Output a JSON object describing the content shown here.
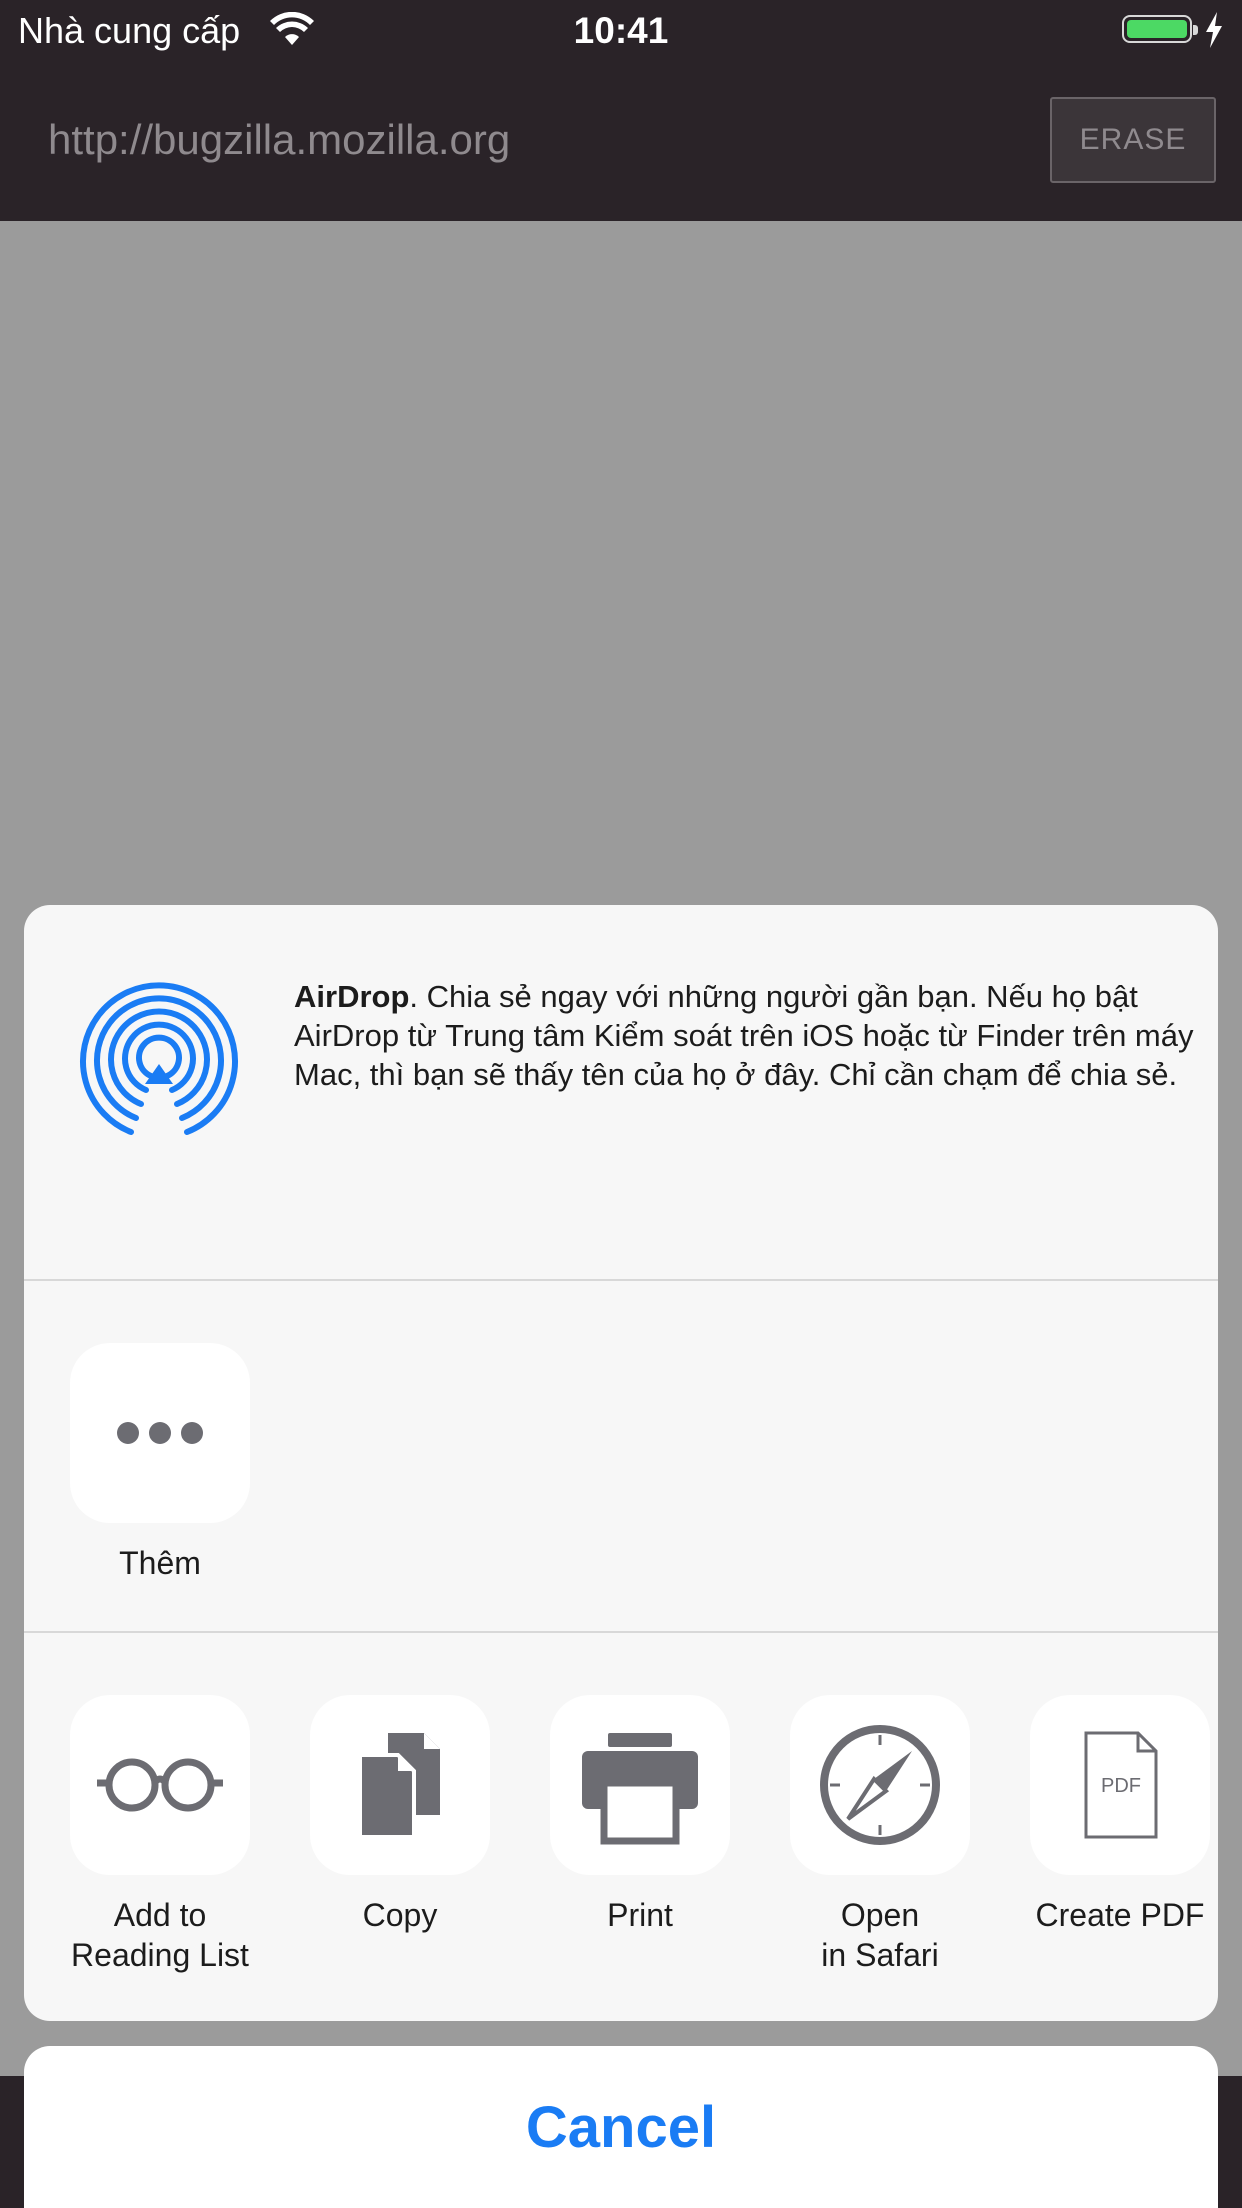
{
  "status_bar": {
    "carrier": "Nhà cung cấp",
    "time": "10:41",
    "wifi_icon": "wifi-icon",
    "battery_icon": "battery-icon",
    "charging_icon": "bolt-icon"
  },
  "header": {
    "url": "http://bugzilla.mozilla.org",
    "erase_label": "ERASE"
  },
  "share_sheet": {
    "airdrop": {
      "icon": "airdrop-icon",
      "title": "AirDrop",
      "description": ". Chia sẻ ngay với những người gần bạn. Nếu họ bật AirDrop từ Trung tâm Kiểm soát trên iOS hoặc từ Finder trên máy Mac, thì bạn sẽ thấy tên của họ ở đây. Chỉ cần chạm để chia sẻ."
    },
    "share_row": [
      {
        "label": "Thêm",
        "icon": "more-dots-icon"
      }
    ],
    "action_row": [
      {
        "label": "Add to\nReading List",
        "icon": "glasses-icon"
      },
      {
        "label": "Copy",
        "icon": "copy-icon"
      },
      {
        "label": "Print",
        "icon": "printer-icon"
      },
      {
        "label": "Open\nin Safari",
        "icon": "compass-icon"
      },
      {
        "label": "Create PDF",
        "icon": "pdf-icon"
      }
    ],
    "cancel_label": "Cancel"
  },
  "colors": {
    "accent": "#1a7cf4",
    "header_bg": "#2a2328",
    "dim_overlay": "#9b9b9b",
    "sheet_bg": "#f7f7f7",
    "icon_gray": "#6c6c72",
    "battery_green": "#4cd964"
  }
}
